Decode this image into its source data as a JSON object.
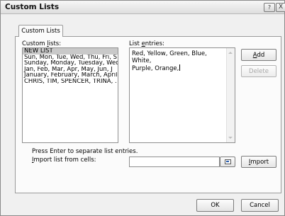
{
  "window": {
    "title": "Custom Lists",
    "help_label": "?",
    "close_label": "X"
  },
  "tab": {
    "label": "Custom Lists"
  },
  "custom_lists": {
    "label_pre": "Custom ",
    "label_key": "l",
    "label_post": "ists:",
    "items": [
      "NEW LIST",
      "Sun, Mon, Tue, Wed, Thu, Fri, S",
      "Sunday, Monday, Tuesday, Wed",
      "Jan, Feb, Mar, Apr, May, Jun, J",
      "January, February, March, April",
      "CHRIS, TIM, SPENCER, TRINA, ."
    ],
    "selected_index": 0
  },
  "list_entries": {
    "label_pre": "List ",
    "label_key": "e",
    "label_post": "ntries:",
    "value": "Red, Yellow, Green, Blue, White,\nPurple, Orange,"
  },
  "buttons": {
    "add_pre": "",
    "add_key": "A",
    "add_post": "dd",
    "delete": "Delete",
    "import_pre": "",
    "import_key": "I",
    "import_post": "mport",
    "ok": "OK",
    "cancel": "Cancel"
  },
  "hint": "Press Enter to separate list entries.",
  "import": {
    "label_pre": "",
    "label_key": "I",
    "label_post": "mport list from cells:",
    "value": ""
  }
}
